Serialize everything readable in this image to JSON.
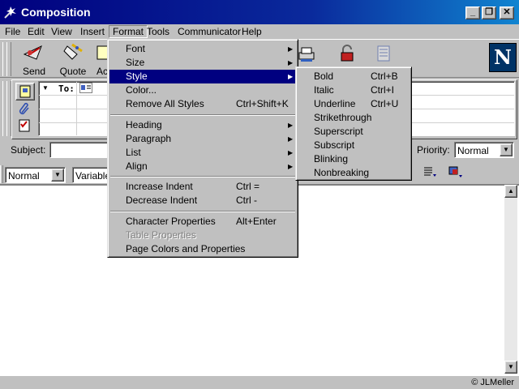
{
  "window": {
    "title": "Composition"
  },
  "menubar": [
    "File",
    "Edit",
    "View",
    "Insert",
    "Format",
    "Tools",
    "Communicator",
    "Help"
  ],
  "toolbar": {
    "send": "Send",
    "quote": "Quote",
    "address_partial": "Ac"
  },
  "address": {
    "to_label": "To:"
  },
  "subject": {
    "label": "Subject:",
    "value": ""
  },
  "priority": {
    "label": "Priority:",
    "value": "Normal"
  },
  "formatbar": {
    "paragraph": "Normal",
    "font": "Variable"
  },
  "format_menu": {
    "font": "Font",
    "size": "Size",
    "style": "Style",
    "color": "Color...",
    "remove_styles": "Remove All Styles",
    "remove_styles_sc": "Ctrl+Shift+K",
    "heading": "Heading",
    "paragraph": "Paragraph",
    "list": "List",
    "align": "Align",
    "increase_indent": "Increase Indent",
    "increase_indent_sc": "Ctrl =",
    "decrease_indent": "Decrease Indent",
    "decrease_indent_sc": "Ctrl -",
    "char_props": "Character Properties",
    "char_props_sc": "Alt+Enter",
    "table_props": "Table Properties",
    "page_colors": "Page Colors and Properties"
  },
  "style_menu": {
    "bold": "Bold",
    "bold_sc": "Ctrl+B",
    "italic": "Italic",
    "italic_sc": "Ctrl+I",
    "underline": "Underline",
    "underline_sc": "Ctrl+U",
    "strikethrough": "Strikethrough",
    "superscript": "Superscript",
    "subscript": "Subscript",
    "blinking": "Blinking",
    "nonbreaking": "Nonbreaking"
  },
  "status": {
    "copyright": "© JLMeller"
  },
  "logo": {
    "letter": "N"
  },
  "colors": {
    "titlebar": "#00007f",
    "face": "#c0c0c0",
    "highlight": "#000080"
  }
}
